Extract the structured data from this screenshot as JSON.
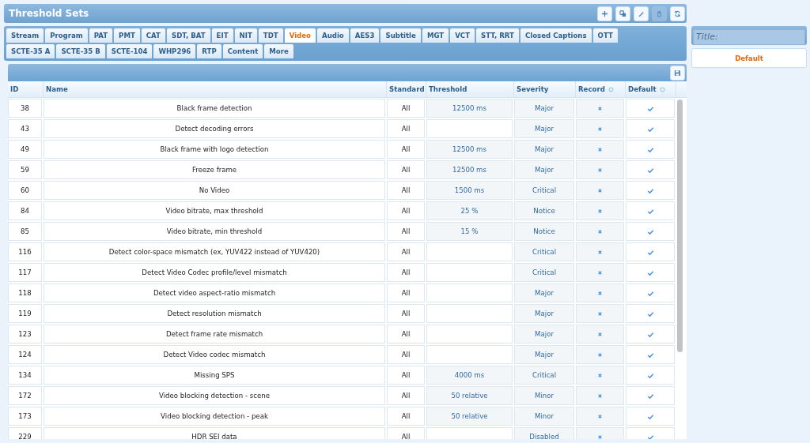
{
  "window": {
    "title": "Threshold Sets"
  },
  "toolbar": [
    {
      "kind": "plus",
      "disabled": false
    },
    {
      "kind": "copy",
      "disabled": false
    },
    {
      "kind": "edit",
      "disabled": false
    },
    {
      "kind": "delete",
      "disabled": true
    },
    {
      "kind": "refresh",
      "disabled": false
    }
  ],
  "tab_rows": [
    [
      {
        "label": "Stream",
        "selected": false
      },
      {
        "label": "Program",
        "selected": false
      },
      {
        "label": "PAT",
        "selected": false
      },
      {
        "label": "PMT",
        "selected": false
      },
      {
        "label": "CAT",
        "selected": false
      },
      {
        "label": "SDT, BAT",
        "selected": false
      },
      {
        "label": "EIT",
        "selected": false
      },
      {
        "label": "NIT",
        "selected": false
      },
      {
        "label": "TDT",
        "selected": false
      },
      {
        "label": "Video",
        "selected": true
      },
      {
        "label": "Audio",
        "selected": false
      },
      {
        "label": "AES3",
        "selected": false
      },
      {
        "label": "Subtitle",
        "selected": false
      },
      {
        "label": "MGT",
        "selected": false
      },
      {
        "label": "VCT",
        "selected": false
      },
      {
        "label": "STT, RRT",
        "selected": false
      },
      {
        "label": "Closed Captions",
        "selected": false
      },
      {
        "label": "OTT",
        "selected": false
      }
    ],
    [
      {
        "label": "SCTE-35 A",
        "selected": false
      },
      {
        "label": "SCTE-35 B",
        "selected": false
      },
      {
        "label": "SCTE-104",
        "selected": false
      },
      {
        "label": "WHP296",
        "selected": false
      },
      {
        "label": "RTP",
        "selected": false
      },
      {
        "label": "Content",
        "selected": false
      },
      {
        "label": "More",
        "selected": false
      }
    ]
  ],
  "table": {
    "columns": [
      {
        "label": "ID",
        "sortable": false
      },
      {
        "label": "Name",
        "sortable": false
      },
      {
        "label": "Standard",
        "sortable": false
      },
      {
        "label": "Threshold",
        "sortable": false
      },
      {
        "label": "Severity",
        "sortable": false
      },
      {
        "label": "Record",
        "sortable": true
      },
      {
        "label": "Default",
        "sortable": true
      }
    ],
    "rows": [
      {
        "id": "38",
        "name": "Black frame detection",
        "standard": "All",
        "threshold": "12500 ms",
        "severity": "Major",
        "record": false,
        "default": true
      },
      {
        "id": "43",
        "name": "Detect decoding errors",
        "standard": "All",
        "severity": "Major",
        "record": false,
        "default": true
      },
      {
        "id": "49",
        "name": "Black frame with logo detection",
        "standard": "All",
        "threshold": "12500 ms",
        "severity": "Major",
        "record": false,
        "default": true
      },
      {
        "id": "59",
        "name": "Freeze frame",
        "standard": "All",
        "threshold": "12500 ms",
        "severity": "Major",
        "record": false,
        "default": true
      },
      {
        "id": "60",
        "name": "No Video",
        "standard": "All",
        "threshold": "1500 ms",
        "severity": "Critical",
        "record": false,
        "default": true
      },
      {
        "id": "84",
        "name": "Video bitrate, max threshold",
        "standard": "All",
        "threshold": "25 %",
        "severity": "Notice",
        "record": false,
        "default": true
      },
      {
        "id": "85",
        "name": "Video bitrate, min threshold",
        "standard": "All",
        "threshold": "15 %",
        "severity": "Notice",
        "record": false,
        "default": true
      },
      {
        "id": "116",
        "name": "Detect color-space mismatch (ex, YUV422 instead of YUV420)",
        "standard": "All",
        "severity": "Critical",
        "record": false,
        "default": true
      },
      {
        "id": "117",
        "name": "Detect Video Codec profile/level mismatch",
        "standard": "All",
        "severity": "Critical",
        "record": false,
        "default": true
      },
      {
        "id": "118",
        "name": "Detect video aspect-ratio mismatch",
        "standard": "All",
        "severity": "Major",
        "record": false,
        "default": true
      },
      {
        "id": "119",
        "name": "Detect resolution mismatch",
        "standard": "All",
        "severity": "Major",
        "record": false,
        "default": true
      },
      {
        "id": "123",
        "name": "Detect frame rate mismatch",
        "standard": "All",
        "severity": "Major",
        "record": false,
        "default": true
      },
      {
        "id": "124",
        "name": "Detect Video codec mismatch",
        "standard": "All",
        "severity": "Major",
        "record": false,
        "default": true
      },
      {
        "id": "134",
        "name": "Missing SPS",
        "standard": "All",
        "threshold": "4000 ms",
        "severity": "Critical",
        "record": false,
        "default": true
      },
      {
        "id": "172",
        "name": "Video blocking detection - scene",
        "standard": "All",
        "threshold": "50 relative",
        "severity": "Minor",
        "record": false,
        "default": true
      },
      {
        "id": "173",
        "name": "Video blocking detection - peak",
        "standard": "All",
        "threshold": "50 relative",
        "severity": "Minor",
        "record": false,
        "default": true
      },
      {
        "id": "229",
        "name": "HDR SEI data",
        "standard": "All",
        "severity": "Disabled",
        "record": false,
        "default": true
      }
    ]
  },
  "sidebar": {
    "title_field": {
      "placeholder": "Title:"
    },
    "sets": [
      {
        "label": "Default",
        "selected": true
      }
    ]
  }
}
